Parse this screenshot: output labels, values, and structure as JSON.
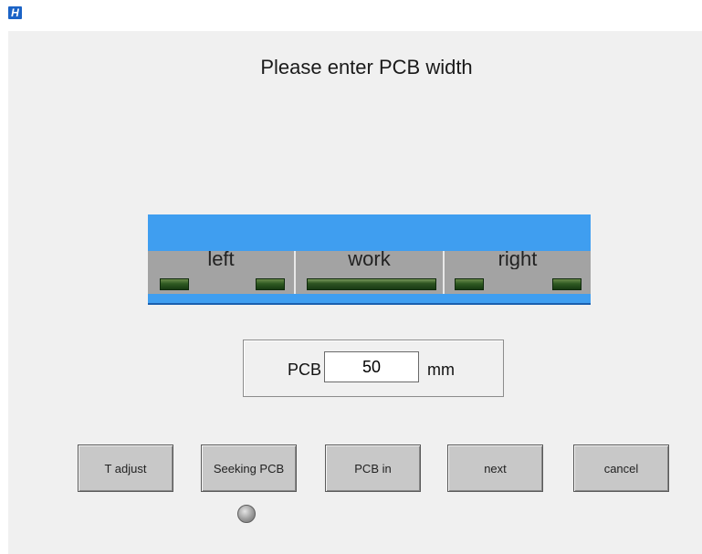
{
  "app": {
    "icon_glyph": "H"
  },
  "title": "Please enter PCB width",
  "conveyor": {
    "segments": [
      {
        "label": "left"
      },
      {
        "label": "work"
      },
      {
        "label": "right"
      }
    ],
    "colors": {
      "rail": "#3f9ef0",
      "track": "#a3a3a3",
      "led": "#2f5a22"
    }
  },
  "pcb_width": {
    "label": "PCB",
    "value": "50",
    "unit": "mm"
  },
  "buttons": {
    "t_adjust": "T adjust",
    "seeking_pcb": "Seeking PCB",
    "pcb_in": "PCB in",
    "next": "next",
    "cancel": "cancel"
  },
  "seeking_indicator": {
    "state": "off"
  }
}
